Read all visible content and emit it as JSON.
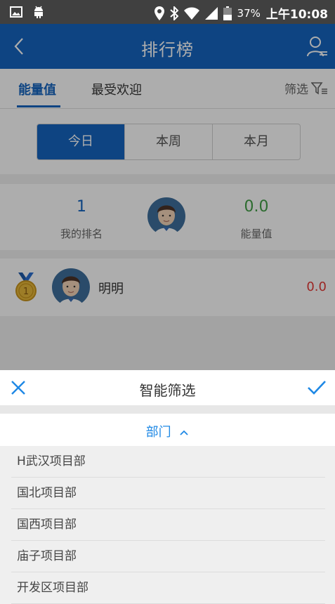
{
  "status_bar": {
    "battery": "37%",
    "time": "上午10:08",
    "icons": [
      "image-icon",
      "android-icon",
      "location-icon",
      "bluetooth-icon",
      "wifi-icon",
      "signal-icon",
      "battery-icon"
    ]
  },
  "header": {
    "title": "排行榜",
    "back_icon": "chevron-left-icon",
    "user_icon": "user-list-icon"
  },
  "tabs": {
    "items": [
      {
        "label": "能量值",
        "active": true
      },
      {
        "label": "最受欢迎",
        "active": false
      }
    ],
    "filter_label": "筛选"
  },
  "period": {
    "items": [
      {
        "label": "今日",
        "active": true
      },
      {
        "label": "本周",
        "active": false
      },
      {
        "label": "本月",
        "active": false
      }
    ]
  },
  "my_stats": {
    "rank": "1",
    "rank_label": "我的排名",
    "energy": "0.0",
    "energy_label": "能量值"
  },
  "ranking": [
    {
      "medal": "1",
      "name": "明明",
      "score": "0.0"
    }
  ],
  "filter_sheet": {
    "title": "智能筛选",
    "department_label": "部门",
    "departments": [
      "H武汉项目部",
      "国北项目部",
      "国西项目部",
      "庙子项目部",
      "开发区项目部"
    ]
  },
  "colors": {
    "primary": "#1565c0",
    "energy_green": "#43a047",
    "score_red": "#e53935",
    "status_bar": "#404040"
  }
}
